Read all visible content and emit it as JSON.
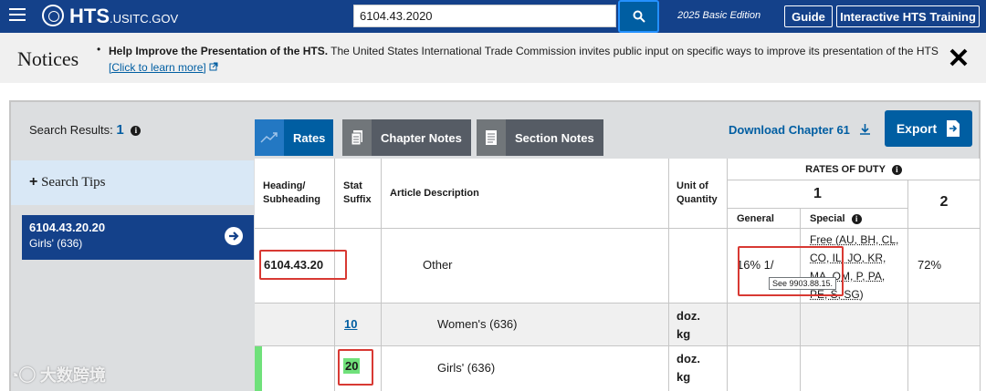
{
  "header": {
    "logo_big": "HTS",
    "logo_small": ".USITC.GOV",
    "search_value": "6104.43.2020",
    "edition": "2025 Basic Edition",
    "guide_label": "Guide",
    "training_label": "Interactive HTS Training"
  },
  "notices": {
    "title": "Notices",
    "bold": "Help Improve the Presentation of the HTS.",
    "text": " The United States International Trade Commission invites public input on specific ways to improve its presentation of the HTS ",
    "link": "[Click to learn more]"
  },
  "panel": {
    "search_results_label": "Search Results:",
    "search_results_count": "1",
    "tabs": [
      {
        "label": "Rates"
      },
      {
        "label": "Chapter Notes"
      },
      {
        "label": "Section Notes"
      }
    ],
    "download_label": "Download Chapter 61",
    "export_label": "Export"
  },
  "sidebar": {
    "search_tips": "Search Tips",
    "result": {
      "code": "6104.43.20.20",
      "desc": "Girls' (636)"
    }
  },
  "table": {
    "headers": {
      "heading": "Heading/ Subheading",
      "stat": "Stat Suffix",
      "desc": "Article Description",
      "unit": "Unit of Quantity",
      "rates": "RATES OF DUTY",
      "col1": "1",
      "col2": "2",
      "general": "General",
      "special": "Special"
    },
    "rows": [
      {
        "heading": "6104.43.20",
        "stat": "",
        "desc": "Other",
        "unit": "",
        "general": "16% 1/",
        "special": "Free (AU, BH, CL, CO, IL, JO, KR, MA, OM, P, PA, PE, S, SG)",
        "col2": "72%",
        "tooltip": "See 9903.88.15."
      },
      {
        "heading": "",
        "stat": "10",
        "desc": "Women's (636)",
        "unit_1": "doz.",
        "unit_2": "kg"
      },
      {
        "heading": "",
        "stat": "20",
        "desc": "Girls' (636)",
        "unit_1": "doz.",
        "unit_2": "kg"
      }
    ]
  },
  "colors": {
    "header": "#14418a",
    "accent": "#005ea2",
    "highlight": "#70e17b",
    "annotation": "#d83933"
  },
  "watermark": "大数跨境"
}
